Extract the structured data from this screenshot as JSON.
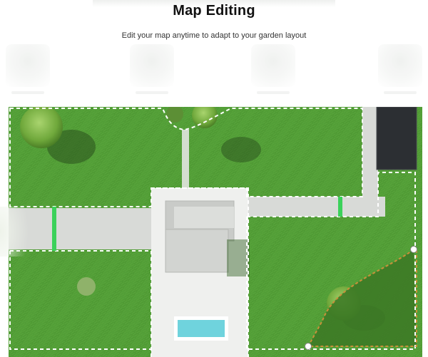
{
  "header": {
    "title": "Map Editing",
    "subtitle": "Edit your map anytime to adapt to your garden layout"
  },
  "colors": {
    "lawn": "#4f9a34",
    "lawn_dark": "#3d7a26",
    "path": "#d9dbd8",
    "house": "#f2f3f2",
    "pool": "#6fd3dd",
    "boundary": "#ffffff",
    "edit_boundary": "#c9903a",
    "solar_panel": "#2c2f33"
  },
  "icons": [
    "ghost-tab-icon",
    "tree-icon",
    "edit-handle-icon"
  ]
}
